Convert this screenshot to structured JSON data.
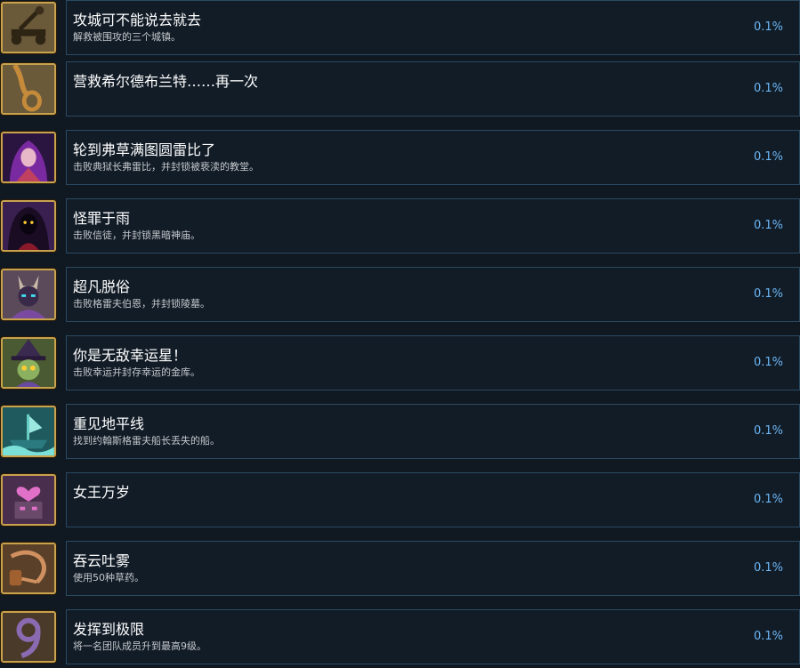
{
  "achievements": [
    {
      "title": "攻城可不能说去就去",
      "desc": "解救被围攻的三个城镇。",
      "percent": "0.1%",
      "icon": "siege-catapult-icon",
      "bg": "#5b4a2c",
      "fg": "#2e2414"
    },
    {
      "title": "营救希尔德布兰特……再一次",
      "desc": "",
      "percent": "0.1%",
      "icon": "rope-noose-icon",
      "bg": "#6a5428",
      "fg": "#c58a3a"
    },
    {
      "title": "轮到弗草满图圆雷比了",
      "desc": "击败典狱长弗雷比，并封锁被亵渎的教堂。",
      "percent": "0.1%",
      "icon": "sorceress-portrait-icon",
      "bg": "#3a1e4e",
      "fg": "#b04ad0"
    },
    {
      "title": "怪罪于雨",
      "desc": "击败信徒，并封锁黑暗神庙。",
      "percent": "0.1%",
      "icon": "hooded-cultist-icon",
      "bg": "#2a1838",
      "fg": "#1a0c22"
    },
    {
      "title": "超凡脱俗",
      "desc": "击败格雷夫伯恩，并封锁陵墓。",
      "percent": "0.1%",
      "icon": "demon-lord-icon",
      "bg": "#4a3a4a",
      "fg": "#7a4aa0"
    },
    {
      "title": "你是无敌幸运星！",
      "desc": "击败幸运并封存幸运的金库。",
      "percent": "0.1%",
      "icon": "goblin-witch-icon",
      "bg": "#3a4a2a",
      "fg": "#6a4aa0"
    },
    {
      "title": "重见地平线",
      "desc": "找到约翰斯格雷夫船长丢失的船。",
      "percent": "0.1%",
      "icon": "ghost-ship-icon",
      "bg": "#1a4a4e",
      "fg": "#6ad0c8"
    },
    {
      "title": "女王万岁",
      "desc": "",
      "percent": "0.1%",
      "icon": "heart-crown-golem-icon",
      "bg": "#4a2e4e",
      "fg": "#e070c8"
    },
    {
      "title": "吞云吐雾",
      "desc": "使用50种草药。",
      "percent": "0.1%",
      "icon": "smoking-pipe-icon",
      "bg": "#5a4028",
      "fg": "#d09060"
    },
    {
      "title": "发挥到极限",
      "desc": "将一名团队成员升到最高9级。",
      "percent": "0.1%",
      "icon": "number-nine-icon",
      "bg": "#3a3040",
      "fg": "#8a6ab0"
    }
  ]
}
